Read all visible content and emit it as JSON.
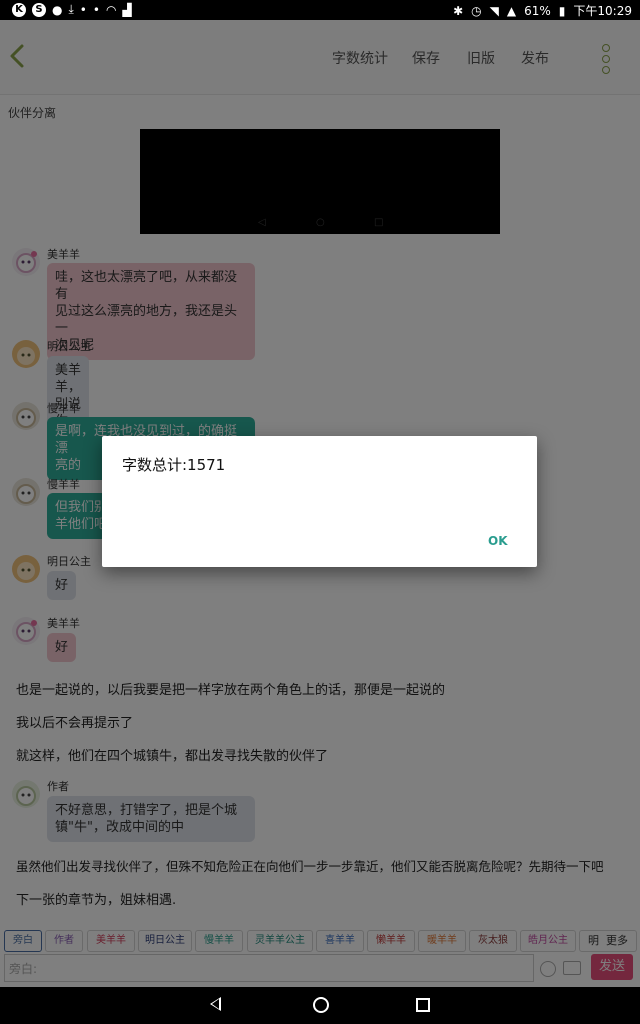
{
  "status_bar": {
    "left_icons": [
      "k-circle-icon",
      "s-circle-icon",
      "notification-icon",
      "download-icon",
      "dot-icon",
      "dot-icon",
      "wifi-icon",
      "activity-icon"
    ],
    "battery": "61%",
    "time": "下午10:29"
  },
  "app_bar": {
    "menu": [
      "字数统计",
      "保存",
      "旧版",
      "发布"
    ]
  },
  "chapter_title": "伙伴分离",
  "messages": [
    {
      "sender": "美羊羊",
      "text": "哇，这也太漂亮了吧，从来都没有见过这么漂亮的地方，我还是头一次见呢",
      "lines": [
        "哇，这也太漂亮了吧，从来都没有",
        "见过这么漂亮的地方，我还是头一",
        "次见呢"
      ]
    },
    {
      "sender": "明日公主",
      "text": "美羊羊，别说你，连我也是"
    },
    {
      "sender": "慢羊羊",
      "lines": [
        "是啊，连我也没见到过，的确挺漂",
        "亮的"
      ]
    },
    {
      "sender": "慢羊羊",
      "lines": [
        "但我们别",
        "羊他们吧"
      ]
    },
    {
      "sender": "明日公主",
      "text": "好"
    },
    {
      "sender": "美羊羊",
      "text": "好"
    }
  ],
  "narrations": [
    "也是一起说的，以后我要是把一样字放在两个角色上的话，那便是一起说的",
    "我以后不会再提示了",
    "就这样，他们在四个城镇牛，都出发寻找失散的伙伴了"
  ],
  "author_message": {
    "sender": "作者",
    "lines": [
      "不好意思，打错字了，把是个城",
      "镇\"牛\"，改成中间的中"
    ]
  },
  "narrations_after": [
    "虽然他们出发寻找伙伴了，但殊不知危险正在向他们一步一步靠近，他们又能否脱离危险呢？先期待一下吧",
    "下一张的章节为，姐妹相遇."
  ],
  "dialog": {
    "message": "字数总计:1571",
    "ok": "OK"
  },
  "roles": [
    {
      "label": "旁白",
      "color": "#4a6fa5"
    },
    {
      "label": "作者",
      "color": "#8a5fb5"
    },
    {
      "label": "美羊羊",
      "color": "#d23c5a"
    },
    {
      "label": "明日公主",
      "color": "#2f3f7a"
    },
    {
      "label": "慢羊羊",
      "color": "#2aa08f"
    },
    {
      "label": "灵羊羊公主",
      "color": "#1f8c7e"
    },
    {
      "label": "喜羊羊",
      "color": "#3a6fc0"
    },
    {
      "label": "懒羊羊",
      "color": "#c03a3a"
    },
    {
      "label": "暖羊羊",
      "color": "#e07a3a"
    },
    {
      "label": "灰太狼",
      "color": "#8a3a3a"
    },
    {
      "label": "皓月公主",
      "color": "#c04aa0"
    },
    {
      "label": "明",
      "color": "#333333"
    },
    {
      "label": "更多",
      "color": "#333333"
    }
  ],
  "input": {
    "placeholder": "旁白:",
    "send": "发送"
  }
}
